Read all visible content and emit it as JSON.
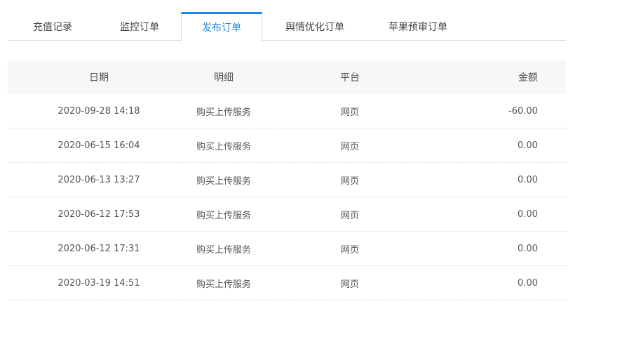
{
  "tabs": [
    {
      "label": "充值记录",
      "active": false
    },
    {
      "label": "监控订单",
      "active": false
    },
    {
      "label": "发布订单",
      "active": true
    },
    {
      "label": "舆情优化订单",
      "active": false
    },
    {
      "label": "苹果预审订单",
      "active": false
    }
  ],
  "table": {
    "headers": [
      "日期",
      "明细",
      "平台",
      "金额"
    ],
    "rows": [
      {
        "date": "2020-09-28 14:18",
        "detail": "购买上传服务",
        "platform": "网页",
        "amount": "-60.00"
      },
      {
        "date": "2020-06-15 16:04",
        "detail": "购买上传服务",
        "platform": "网页",
        "amount": "0.00"
      },
      {
        "date": "2020-06-13 13:27",
        "detail": "购买上传服务",
        "platform": "网页",
        "amount": "0.00"
      },
      {
        "date": "2020-06-12 17:53",
        "detail": "购买上传服务",
        "platform": "网页",
        "amount": "0.00"
      },
      {
        "date": "2020-06-12 17:31",
        "detail": "购买上传服务",
        "platform": "网页",
        "amount": "0.00"
      },
      {
        "date": "2020-03-19 14:51",
        "detail": "购买上传服务",
        "platform": "网页",
        "amount": "0.00"
      }
    ]
  },
  "colors": {
    "accent": "#1e88e5",
    "header_bg": "#f7f7f7",
    "text": "#555555",
    "border": "#dddddd"
  }
}
